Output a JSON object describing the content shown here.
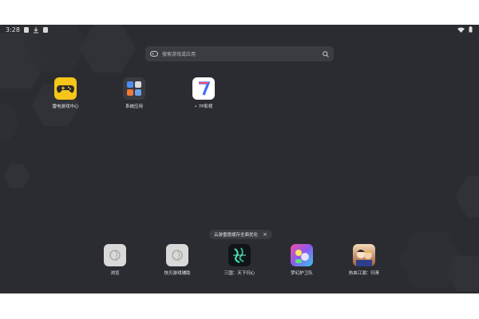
{
  "status_bar": {
    "time": "3:28"
  },
  "search": {
    "placeholder": "搜索游戏或应用"
  },
  "apps": [
    {
      "label": "雷电游戏中心",
      "icon": "gamepad-icon",
      "color": "#f5c518"
    },
    {
      "label": "系统应用",
      "icon": "folder-icon",
      "color": "#3a3b40"
    },
    {
      "label": "• 7P影视",
      "icon": "video-7p-icon",
      "color": "#ffffff"
    }
  ],
  "dock": {
    "tooltip": "云游雷霆缓存全面优化",
    "items": [
      {
        "label": "浏览",
        "icon": "browser-icon"
      },
      {
        "label": "快贝游戏辅助",
        "icon": "helper-icon"
      },
      {
        "label": "三国：天下归心",
        "icon": "sanguo-game-icon"
      },
      {
        "label": "梦幻护卫队",
        "icon": "guard-game-icon"
      },
      {
        "label": "热血江湖：归来",
        "icon": "jianghu-game-icon"
      }
    ]
  },
  "colors": {
    "background": "#2b2c31",
    "accent": "#f5c518"
  }
}
